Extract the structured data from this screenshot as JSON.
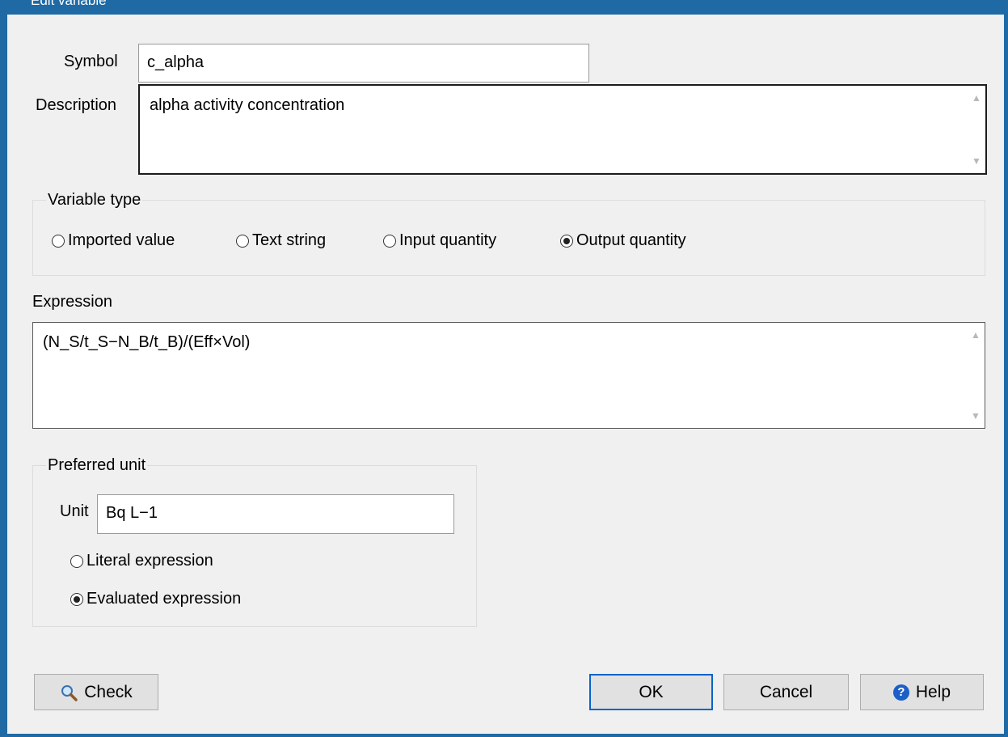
{
  "window": {
    "title": "Edit variable"
  },
  "symbol": {
    "label": "Symbol",
    "value": "c_alpha"
  },
  "description": {
    "label": "Description",
    "value": "alpha activity concentration"
  },
  "variable_type": {
    "legend": "Variable type",
    "options": [
      {
        "label": "Imported value",
        "selected": false
      },
      {
        "label": "Text string",
        "selected": false
      },
      {
        "label": "Input quantity",
        "selected": false
      },
      {
        "label": "Output quantity",
        "selected": true
      }
    ]
  },
  "expression": {
    "label": "Expression",
    "value": "(N_S/t_S−N_B/t_B)/(Eff×Vol)"
  },
  "preferred_unit": {
    "legend": "Preferred unit",
    "unit_label": "Unit",
    "unit_value": "Bq L−1",
    "options": [
      {
        "label": "Literal expression",
        "selected": false
      },
      {
        "label": "Evaluated expression",
        "selected": true
      }
    ]
  },
  "buttons": {
    "check": "Check",
    "ok": "OK",
    "cancel": "Cancel",
    "help": "Help"
  },
  "icons": {
    "check": "magnifier-icon",
    "help": "question-circle-icon"
  },
  "colors": {
    "frame": "#1f6aa5",
    "dialog_bg": "#f0f0f0",
    "default_button_border": "#0a63c9",
    "help_icon": "#1b5fc7"
  }
}
